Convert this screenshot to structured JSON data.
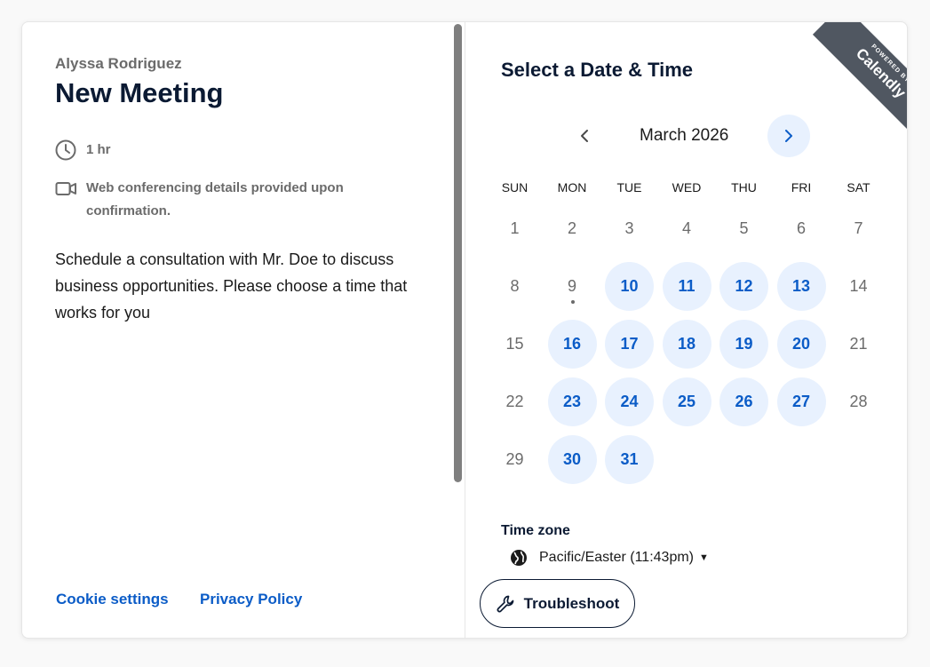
{
  "event": {
    "organizer": "Alyssa Rodriguez",
    "title": "New Meeting",
    "duration": "1 hr",
    "conferencing": "Web conferencing details provided upon confirmation.",
    "description": "Schedule a consultation with Mr. Doe to discuss business opportunities. Please choose a time that works for you"
  },
  "footer": {
    "cookie_settings": "Cookie settings",
    "privacy_policy": "Privacy Policy"
  },
  "calendar": {
    "heading": "Select a Date & Time",
    "month": "March 2026",
    "weekdays": [
      "SUN",
      "MON",
      "TUE",
      "WED",
      "THU",
      "FRI",
      "SAT"
    ],
    "weeks": [
      [
        {
          "d": "1",
          "a": false
        },
        {
          "d": "2",
          "a": false
        },
        {
          "d": "3",
          "a": false
        },
        {
          "d": "4",
          "a": false
        },
        {
          "d": "5",
          "a": false
        },
        {
          "d": "6",
          "a": false
        },
        {
          "d": "7",
          "a": false
        }
      ],
      [
        {
          "d": "8",
          "a": false
        },
        {
          "d": "9",
          "a": false,
          "today": true
        },
        {
          "d": "10",
          "a": true
        },
        {
          "d": "11",
          "a": true
        },
        {
          "d": "12",
          "a": true
        },
        {
          "d": "13",
          "a": true
        },
        {
          "d": "14",
          "a": false
        }
      ],
      [
        {
          "d": "15",
          "a": false
        },
        {
          "d": "16",
          "a": true
        },
        {
          "d": "17",
          "a": true
        },
        {
          "d": "18",
          "a": true
        },
        {
          "d": "19",
          "a": true
        },
        {
          "d": "20",
          "a": true
        },
        {
          "d": "21",
          "a": false
        }
      ],
      [
        {
          "d": "22",
          "a": false
        },
        {
          "d": "23",
          "a": true
        },
        {
          "d": "24",
          "a": true
        },
        {
          "d": "25",
          "a": true
        },
        {
          "d": "26",
          "a": true
        },
        {
          "d": "27",
          "a": true
        },
        {
          "d": "28",
          "a": false
        }
      ],
      [
        {
          "d": "29",
          "a": false
        },
        {
          "d": "30",
          "a": true
        },
        {
          "d": "31",
          "a": true
        }
      ]
    ]
  },
  "timezone": {
    "label": "Time zone",
    "value": "Pacific/Easter (11:43pm)"
  },
  "troubleshoot": {
    "label": "Troubleshoot"
  },
  "badge": {
    "line1": "POWERED BY",
    "line2": "Calendly"
  },
  "colors": {
    "accent": "#0b5cc7",
    "available_bg": "#e8f1fe",
    "heading": "#0b1a33",
    "muted": "#6b6b6b",
    "ribbon": "#505761"
  },
  "icons": {
    "duration": "clock-icon",
    "conferencing": "video-camera-icon",
    "timezone": "globe-icon",
    "troubleshoot": "wrench-icon",
    "prev": "chevron-left-icon",
    "next": "chevron-right-icon"
  }
}
